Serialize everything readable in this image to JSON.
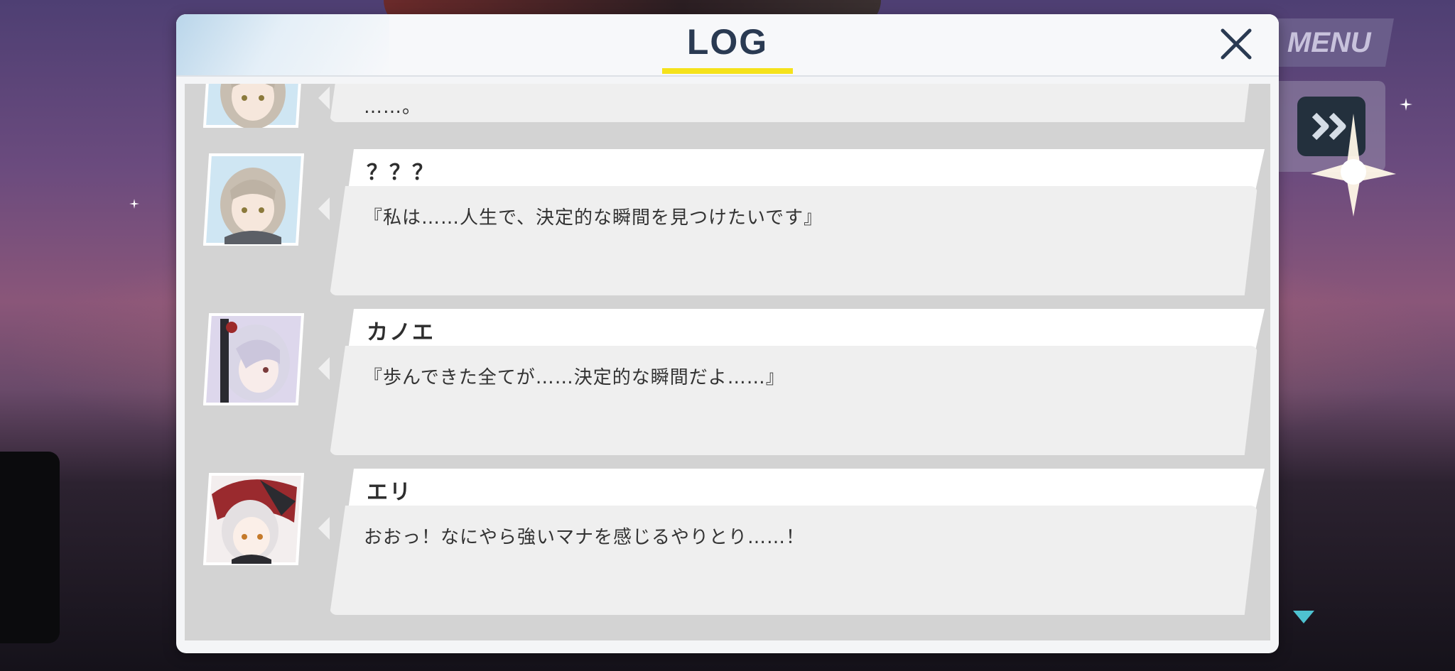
{
  "header": {
    "title": "LOG",
    "close_icon": "close-icon"
  },
  "hud": {
    "menu_label": "MENU",
    "skip_icon": "fast-forward-icon"
  },
  "entries": [
    {
      "name": "",
      "text": "……。",
      "portrait": "girl-beige-hair-portrait"
    },
    {
      "name": "？？？",
      "text": "『私は……人生で、決定的な瞬間を見つけたいです』",
      "portrait": "girl-beige-hair-portrait"
    },
    {
      "name": "カノエ",
      "text": "『歩んできた全てが……決定的な瞬間だよ……』",
      "portrait": "girl-silver-hair-portrait"
    },
    {
      "name": "エリ",
      "text": "おおっ！なにやら強いマナを感じるやりとり……！",
      "portrait": "girl-red-hood-portrait"
    }
  ],
  "colors": {
    "title": "#2a3a52",
    "underline": "#f5e21b",
    "panel": "#d3d3d3",
    "menu_bg": "#6a5d8a",
    "skip_bg": "#23303d"
  }
}
